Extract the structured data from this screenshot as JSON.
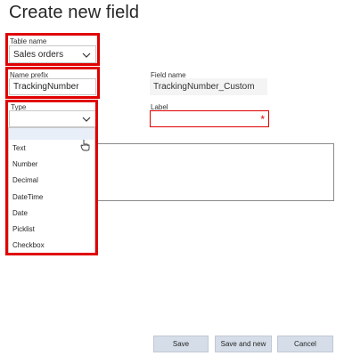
{
  "dialog": {
    "title": "Create new field"
  },
  "table_name": {
    "label": "Table name",
    "value": "Sales orders"
  },
  "name_prefix": {
    "label": "Name prefix",
    "value": "TrackingNumber"
  },
  "field_name": {
    "label": "Field name",
    "value": "TrackingNumber_Custom"
  },
  "label_field": {
    "label": "Label",
    "value": "",
    "required_marker": "*"
  },
  "type": {
    "label": "Type",
    "value": "",
    "options": [
      "Text",
      "Number",
      "Decimal",
      "DateTime",
      "Date",
      "Picklist",
      "Checkbox"
    ]
  },
  "footer": {
    "save_label": "Save",
    "save_and_new_label": "Save and new",
    "cancel_label": "Cancel"
  },
  "colors": {
    "highlight": "#e00000",
    "button_bg": "#d5dde8",
    "required": "#e00000"
  }
}
